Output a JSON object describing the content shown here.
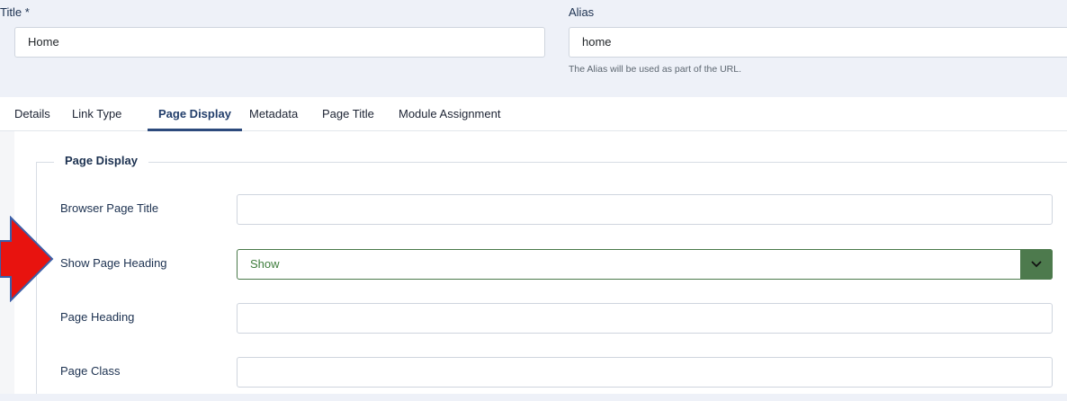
{
  "form": {
    "title_label": "Title *",
    "title_value": "Home",
    "alias_label": "Alias",
    "alias_value": "home",
    "alias_hint": "The Alias will be used as part of the URL."
  },
  "tabs": [
    {
      "label": "Details"
    },
    {
      "label": "Link Type"
    },
    {
      "label": "Page Display",
      "active": true
    },
    {
      "label": "Metadata"
    },
    {
      "label": "Page Title"
    },
    {
      "label": "Module Assignment"
    }
  ],
  "page_display": {
    "legend": "Page Display",
    "browser_title_label": "Browser Page Title",
    "browser_title_value": "",
    "show_heading_label": "Show Page Heading",
    "show_heading_value": "Show",
    "page_heading_label": "Page Heading",
    "page_heading_value": "",
    "page_class_label": "Page Class",
    "page_class_value": ""
  },
  "colors": {
    "accent": "#2c4a7c",
    "select_green": "#4d7a4d",
    "annotation_arrow": "#e8130f"
  },
  "icons": {
    "select_toggle": "chevron-down-icon",
    "annotation": "arrow-right-icon"
  }
}
